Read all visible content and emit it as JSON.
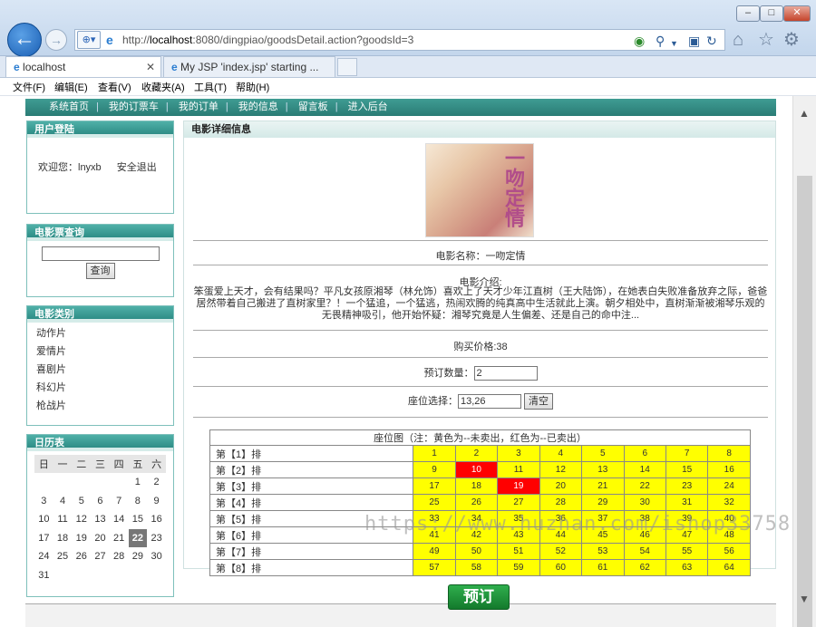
{
  "window": {
    "min": "–",
    "max": "□",
    "close": "✕"
  },
  "toolbar": {
    "url_prefix": "http://",
    "url_host": "localhost",
    "url_rest": ":8080/dingpiao/goodsDetail.action?goodsId=3",
    "back": "←",
    "fwd": "→"
  },
  "tabs": [
    {
      "label": "localhost",
      "close": "✕"
    },
    {
      "label": "My JSP 'index.jsp' starting ..."
    }
  ],
  "menu": [
    "文件(F)",
    "编辑(E)",
    "查看(V)",
    "收藏夹(A)",
    "工具(T)",
    "帮助(H)"
  ],
  "nav": [
    "系统首页",
    "我的订票车",
    "我的订单",
    "我的信息",
    "留言板",
    "进入后台"
  ],
  "login": {
    "title": "用户登陆",
    "welcome": "欢迎您：lnyxb",
    "logout": "安全退出"
  },
  "search": {
    "title": "电影票查询",
    "value": "",
    "button": "查询"
  },
  "cats": {
    "title": "电影类别",
    "items": [
      "动作片",
      "爱情片",
      "喜剧片",
      "科幻片",
      "枪战片"
    ]
  },
  "cal": {
    "title": "日历表",
    "headers": [
      "日",
      "一",
      "二",
      "三",
      "四",
      "五",
      "六"
    ],
    "today": "22",
    "weeks": [
      [
        "",
        "",
        "",
        "",
        "",
        "1",
        "2"
      ],
      [
        "3",
        "4",
        "5",
        "6",
        "7",
        "8",
        "9"
      ],
      [
        "10",
        "11",
        "12",
        "13",
        "14",
        "15",
        "16"
      ],
      [
        "17",
        "18",
        "19",
        "20",
        "21",
        "22",
        "23"
      ],
      [
        "24",
        "25",
        "26",
        "27",
        "28",
        "29",
        "30"
      ],
      [
        "31",
        "",
        "",
        "",
        "",
        "",
        ""
      ]
    ]
  },
  "detail": {
    "title": "电影详细信息",
    "poster_text": "一吻定情",
    "name_label": "电影名称：一吻定情",
    "desc_label": "电影介绍:",
    "desc": "笨蛋爱上天才，会有结果吗？平凡女孩原湘琴（林允饰）喜欢上了天才少年江直树（王大陆饰），在她表白失败准备放弃之际，爸爸居然带着自己搬进了直树家里？！一个猛追，一个猛逃，热闹欢腾的纯真高中生活就此上演。朝夕相处中，直树渐渐被湘琴乐观的无畏精神吸引，他开始怀疑：湘琴究竟是人生偏差、还是自己的命中注...",
    "price": "购买价格:38",
    "qty_label": "预订数量：",
    "qty": "2",
    "seat_label": "座位选择：",
    "seat": "13,26",
    "clear": "清空",
    "seat_caption": "座位图（注：黄色为--未卖出，红色为--已卖出）",
    "order": "预订"
  },
  "seats": {
    "rows": [
      "第【1】排",
      "第【2】排",
      "第【3】排",
      "第【4】排",
      "第【5】排",
      "第【6】排",
      "第【7】排",
      "第【8】排"
    ],
    "sold": [
      "10",
      "19"
    ],
    "cells": [
      [
        "1",
        "2",
        "3",
        "4",
        "5",
        "6",
        "7",
        "8"
      ],
      [
        "9",
        "10",
        "11",
        "12",
        "13",
        "14",
        "15",
        "16"
      ],
      [
        "17",
        "18",
        "19",
        "20",
        "21",
        "22",
        "23",
        "24"
      ],
      [
        "25",
        "26",
        "27",
        "28",
        "29",
        "30",
        "31",
        "32"
      ],
      [
        "33",
        "34",
        "35",
        "36",
        "37",
        "38",
        "39",
        "40"
      ],
      [
        "41",
        "42",
        "43",
        "44",
        "45",
        "46",
        "47",
        "48"
      ],
      [
        "49",
        "50",
        "51",
        "52",
        "53",
        "54",
        "55",
        "56"
      ],
      [
        "57",
        "58",
        "59",
        "60",
        "61",
        "62",
        "63",
        "64"
      ]
    ]
  },
  "watermark": "https://www.huzhan.com/ishop33758",
  "colors": {
    "sold": "#ff0000",
    "available": "#ffff00",
    "nav": "#2e8d86"
  }
}
